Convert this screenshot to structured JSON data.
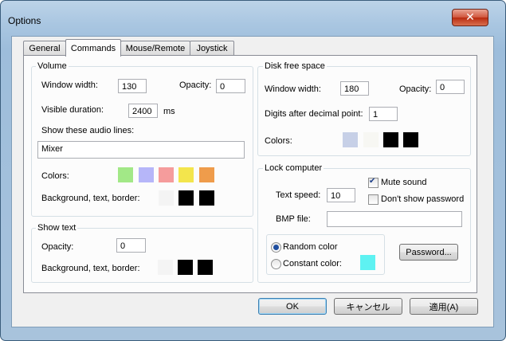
{
  "window": {
    "title": "Options"
  },
  "tabs": [
    {
      "label": "General"
    },
    {
      "label": "Commands"
    },
    {
      "label": "Mouse/Remote"
    },
    {
      "label": "Joystick"
    }
  ],
  "volume": {
    "title": "Volume",
    "window_width_label": "Window width:",
    "window_width_value": "130",
    "opacity_label": "Opacity:",
    "opacity_value": "0",
    "visible_duration_label": "Visible duration:",
    "visible_duration_value": "2400",
    "ms_label": "ms",
    "audio_lines_label": "Show these audio lines:",
    "audio_lines_value": "Mixer",
    "colors_label": "Colors:",
    "colors": [
      "#a2e887",
      "#b6b6f9",
      "#f59c9c",
      "#f3e54c",
      "#ef9c4b"
    ],
    "bg_text_border_label": "Background, text, border:",
    "bg_text_border_colors": [
      "#f4f4f4",
      "#000000",
      "#000000"
    ]
  },
  "show_text": {
    "title": "Show text",
    "opacity_label": "Opacity:",
    "opacity_value": "0",
    "bg_text_border_label": "Background, text, border:",
    "bg_text_border_colors": [
      "#f4f4f4",
      "#000000",
      "#000000"
    ]
  },
  "disk": {
    "title": "Disk free space",
    "window_width_label": "Window width:",
    "window_width_value": "180",
    "opacity_label": "Opacity:",
    "opacity_value": "0",
    "digits_label": "Digits after decimal point:",
    "digits_value": "1",
    "colors_label": "Colors:",
    "colors": [
      "#c7d0e7",
      "#f7f7f3",
      "#000000",
      "#000000"
    ]
  },
  "lock": {
    "title": "Lock computer",
    "text_speed_label": "Text  speed:",
    "text_speed_value": "10",
    "mute_label": "Mute sound",
    "mute_checked": true,
    "dont_show_label": "Don't  show password",
    "dont_show_checked": false,
    "bmp_label": "BMP file:",
    "bmp_value": "",
    "random_label": "Random color",
    "constant_label": "Constant color:",
    "constant_color": "#5ef2f2",
    "password_button": "Password..."
  },
  "buttons": {
    "ok": "OK",
    "cancel": "キャンセル",
    "apply": "適用(A)"
  }
}
